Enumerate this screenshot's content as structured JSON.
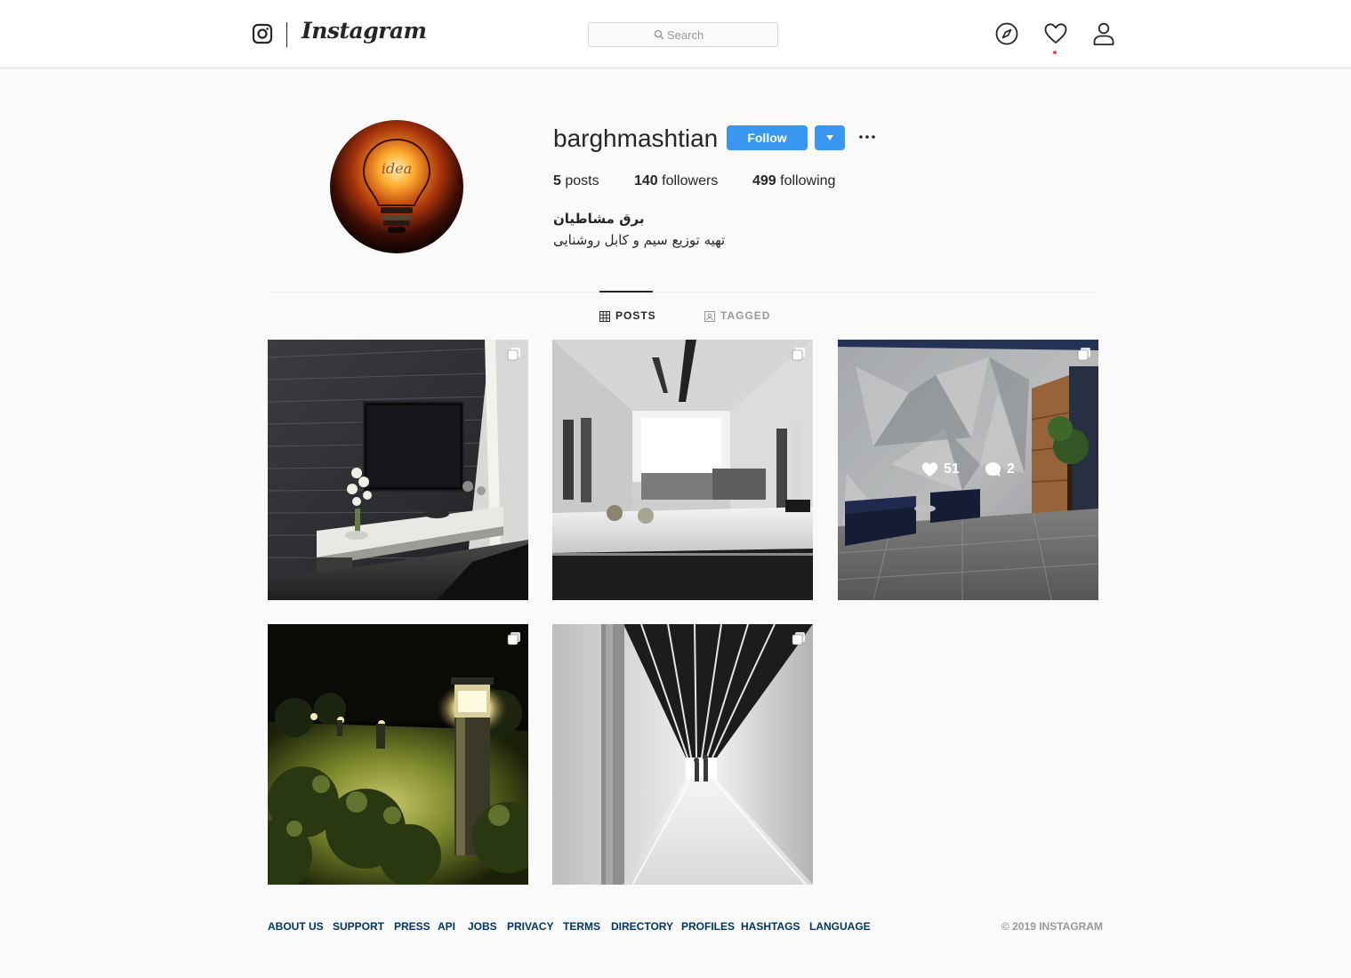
{
  "nav": {
    "wordmark": "Instagram",
    "search_placeholder": "Search",
    "icons": [
      "camera-logo-icon",
      "compass-icon",
      "heart-icon",
      "person-icon"
    ]
  },
  "profile": {
    "username": "barghmashtian",
    "follow_label": "Follow",
    "stats": {
      "posts_count": "5",
      "posts_label": "posts",
      "followers_count": "140",
      "followers_label": "followers",
      "following_count": "499",
      "following_label": "following"
    },
    "full_name": "برق مشاطیان",
    "bio": "تهیه توزیع سیم و کابل روشنایی"
  },
  "tabs": [
    {
      "label": "POSTS",
      "active": true
    },
    {
      "label": "TAGGED",
      "active": false
    }
  ],
  "posts": [
    {
      "subject": "tv wall with stone backlit panel",
      "multi": true
    },
    {
      "subject": "modern kitchen interior",
      "multi": true
    },
    {
      "subject": "lobby with geometric wall",
      "multi": true,
      "likes": "51",
      "comments": "2"
    },
    {
      "subject": "garden bollard lights at night",
      "multi": true
    },
    {
      "subject": "linear lit corridor",
      "multi": true
    }
  ],
  "footer": {
    "links": [
      "ABOUT US",
      "SUPPORT",
      "PRESS",
      "API",
      "JOBS",
      "PRIVACY",
      "TERMS",
      "DIRECTORY",
      "PROFILES",
      "HASHTAGS",
      "LANGUAGE"
    ],
    "copyright": "© 2019 INSTAGRAM"
  },
  "colors": {
    "accent": "#3897f0",
    "link": "#003569",
    "border": "#dbdbdb",
    "background": "#fafafa"
  }
}
